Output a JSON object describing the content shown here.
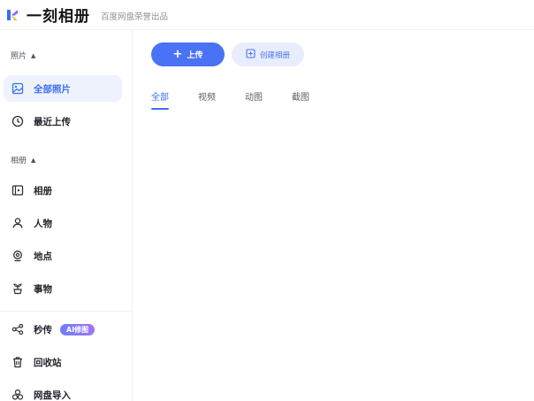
{
  "header": {
    "app_name": "一刻相册",
    "tagline": "百度网盘荣誉出品"
  },
  "sidebar": {
    "photos_section": "照片",
    "albums_section": "相册",
    "items": [
      {
        "label": "全部照片",
        "icon": "image-icon"
      },
      {
        "label": "最近上传",
        "icon": "clock-icon"
      },
      {
        "label": "相册",
        "icon": "album-icon"
      },
      {
        "label": "人物",
        "icon": "person-icon"
      },
      {
        "label": "地点",
        "icon": "location-icon"
      },
      {
        "label": "事物",
        "icon": "plant-icon"
      },
      {
        "label": "秒传",
        "icon": "share-icon"
      },
      {
        "label": "回收站",
        "icon": "trash-icon"
      },
      {
        "label": "网盘导入",
        "icon": "cloud-import-icon"
      }
    ],
    "ai_badge": "AI修图"
  },
  "toolbar": {
    "upload_label": "上传",
    "create_album_label": "创建相册"
  },
  "tabs": [
    {
      "label": "全部",
      "active": true
    },
    {
      "label": "视频",
      "active": false
    },
    {
      "label": "动图",
      "active": false
    },
    {
      "label": "截图",
      "active": false
    }
  ],
  "colors": {
    "accent": "#4a72f5",
    "accent_light": "#e8edfd",
    "active_bg": "#eef2fd"
  }
}
